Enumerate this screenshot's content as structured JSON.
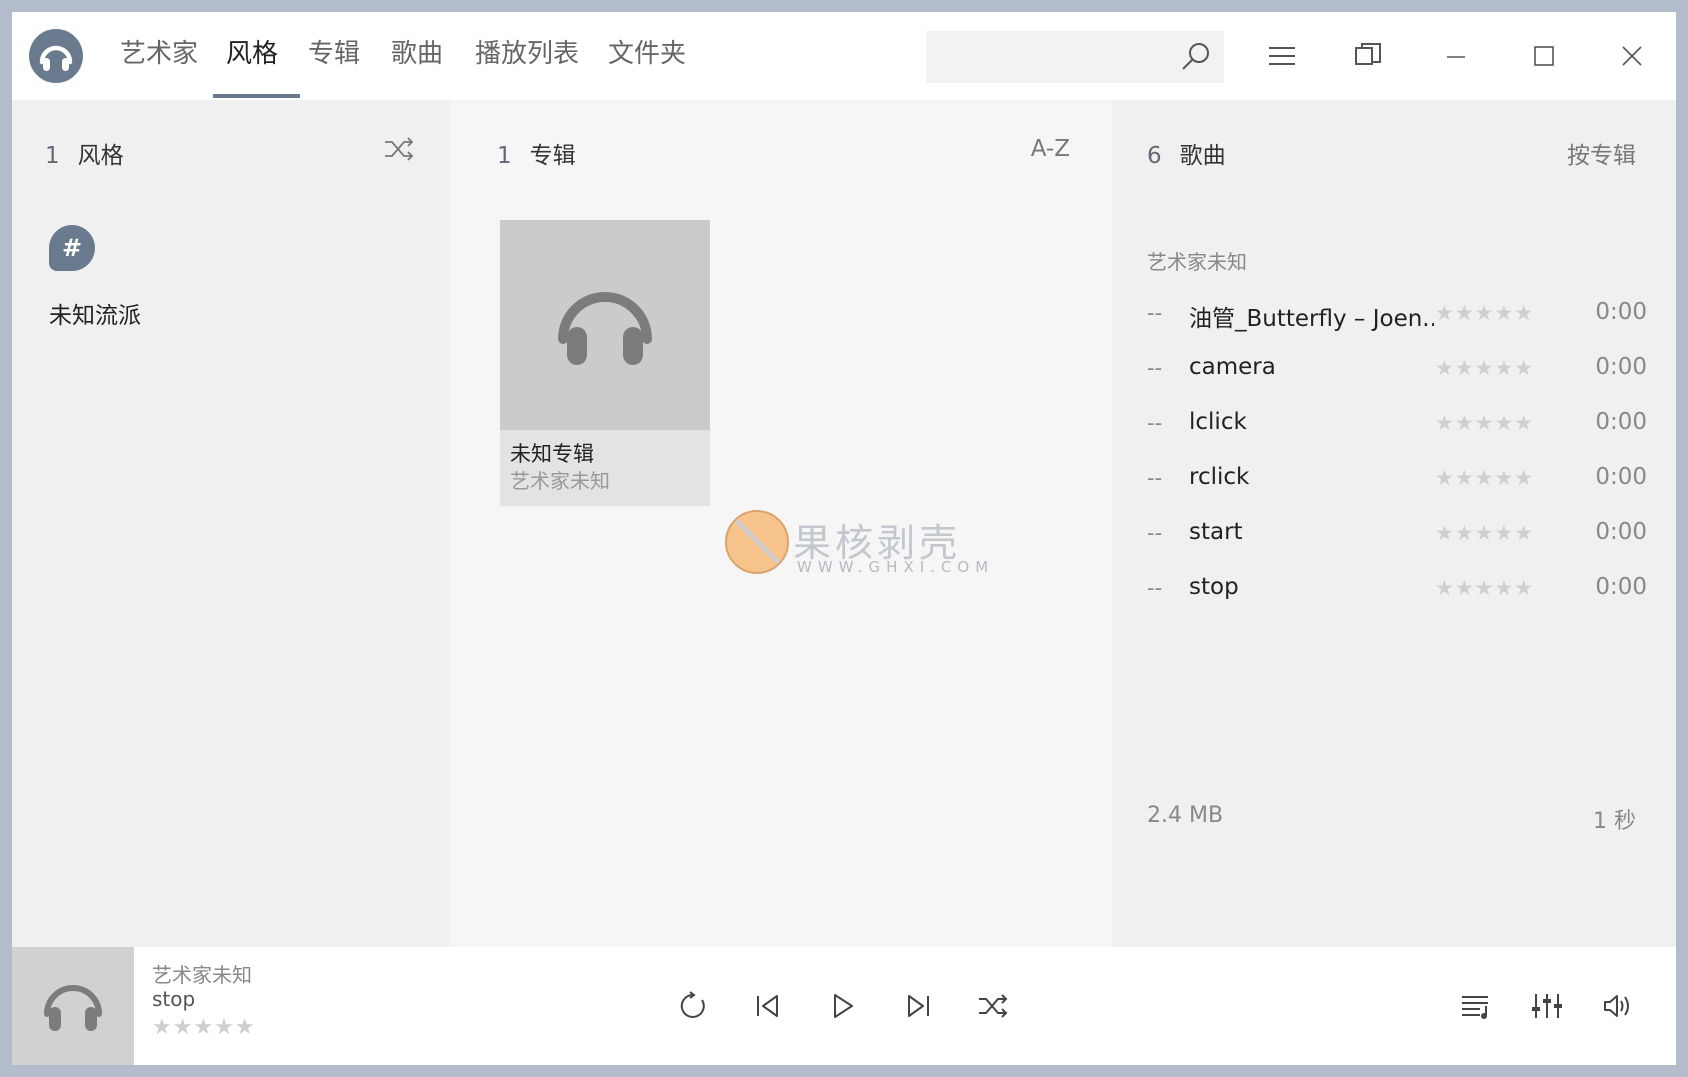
{
  "nav": {
    "tabs": [
      {
        "label": "艺术家"
      },
      {
        "label": "风格"
      },
      {
        "label": "专辑"
      },
      {
        "label": "歌曲"
      },
      {
        "label": "播放列表"
      },
      {
        "label": "文件夹"
      }
    ],
    "active_tab": "风格"
  },
  "search": {
    "value": "",
    "placeholder": ""
  },
  "genre_col": {
    "count": "1",
    "title": "风格",
    "group_symbol": "#",
    "items": [
      {
        "name": "未知流派"
      }
    ]
  },
  "album_col": {
    "count": "1",
    "title": "专辑",
    "sort_label": "A-Z",
    "albums": [
      {
        "title": "未知专辑",
        "artist": "艺术家未知"
      }
    ]
  },
  "watermark": {
    "text": "果核剥壳",
    "sub": "WWW.GHXI.COM"
  },
  "songs_col": {
    "count": "6",
    "title": "歌曲",
    "sort_label": "按专辑",
    "group_label": "艺术家未知",
    "songs": [
      {
        "num": "--",
        "title": "油管_Butterfly – Joen...",
        "rating": "★★★★★",
        "duration": "0:00"
      },
      {
        "num": "--",
        "title": "camera",
        "rating": "★★★★★",
        "duration": "0:00"
      },
      {
        "num": "--",
        "title": "lclick",
        "rating": "★★★★★",
        "duration": "0:00"
      },
      {
        "num": "--",
        "title": "rclick",
        "rating": "★★★★★",
        "duration": "0:00"
      },
      {
        "num": "--",
        "title": "start",
        "rating": "★★★★★",
        "duration": "0:00"
      },
      {
        "num": "--",
        "title": "stop",
        "rating": "★★★★★",
        "duration": "0:00"
      }
    ],
    "total_size": "2.4 MB",
    "total_time": "1 秒"
  },
  "player": {
    "artist": "艺术家未知",
    "title": "stop",
    "rating": "★★★★★",
    "rating_value": 0,
    "icons": [
      "repeat-icon",
      "previous-icon",
      "play-icon",
      "next-icon",
      "shuffle-icon",
      "queue-icon",
      "equalizer-icon",
      "volume-icon"
    ]
  },
  "colors": {
    "accent": "#697a8e",
    "frame": "#b3bccb",
    "star_inactive": "#cfcfcf"
  }
}
